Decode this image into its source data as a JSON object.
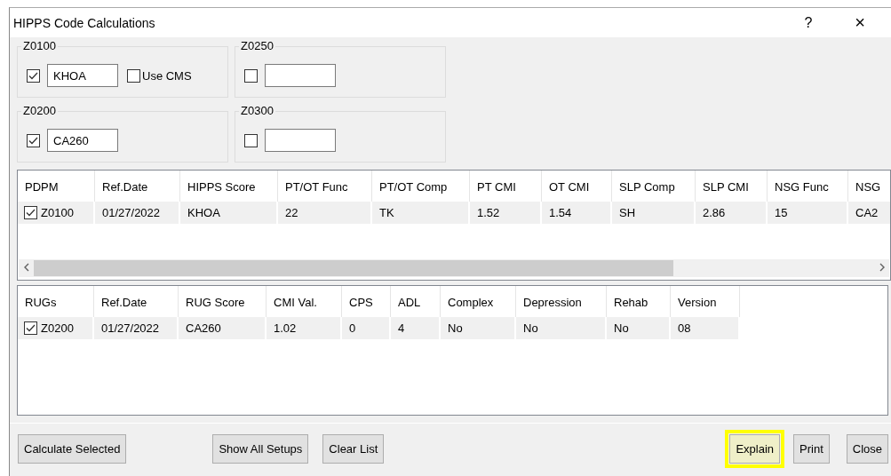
{
  "window": {
    "title": "HIPPS Code Calculations",
    "help": "?",
    "close": "×"
  },
  "groups": [
    {
      "label": "Z0100",
      "checked": true,
      "value": "KHOA",
      "option": {
        "label": "Use CMS",
        "checked": false
      }
    },
    {
      "label": "Z0250",
      "checked": false
    },
    {
      "label": "Z0200",
      "checked": true,
      "value": "CA260"
    },
    {
      "label": "Z0300",
      "checked": false
    }
  ],
  "grids": [
    {
      "columns": [
        "PDPM",
        "Ref.Date",
        "HIPPS Score",
        "PT/OT Func",
        "PT/OT Comp",
        "PT  CMI",
        "OT CMI",
        "SLP Comp",
        "SLP CMI",
        "NSG Func",
        "NSG"
      ],
      "rows": [
        {
          "checked": true,
          "cells": [
            "Z0100",
            "01/27/2022",
            "KHOA",
            "22",
            "TK",
            "1.52",
            "1.54",
            "SH",
            "2.86",
            "15",
            "CA2"
          ]
        }
      ]
    },
    {
      "columns": [
        "RUGs",
        "Ref.Date",
        "RUG Score",
        "CMI Val.",
        "CPS",
        "ADL",
        "Complex",
        "Depression",
        "Rehab",
        "Version"
      ],
      "rows": [
        {
          "checked": true,
          "cells": [
            "Z0200",
            "01/27/2022",
            "CA260",
            "1.02",
            "0",
            "4",
            "No",
            "No",
            "No",
            "08"
          ]
        }
      ]
    }
  ],
  "buttons": [
    {
      "label": "Calculate Selected",
      "highlighted": false
    },
    {
      "label": "Show All Setups",
      "highlighted": false
    },
    {
      "label": "Clear List",
      "highlighted": false
    },
    {
      "label": "Explain",
      "highlighted": true
    },
    {
      "label": "Print",
      "highlighted": false
    },
    {
      "label": "Close",
      "highlighted": false
    }
  ]
}
